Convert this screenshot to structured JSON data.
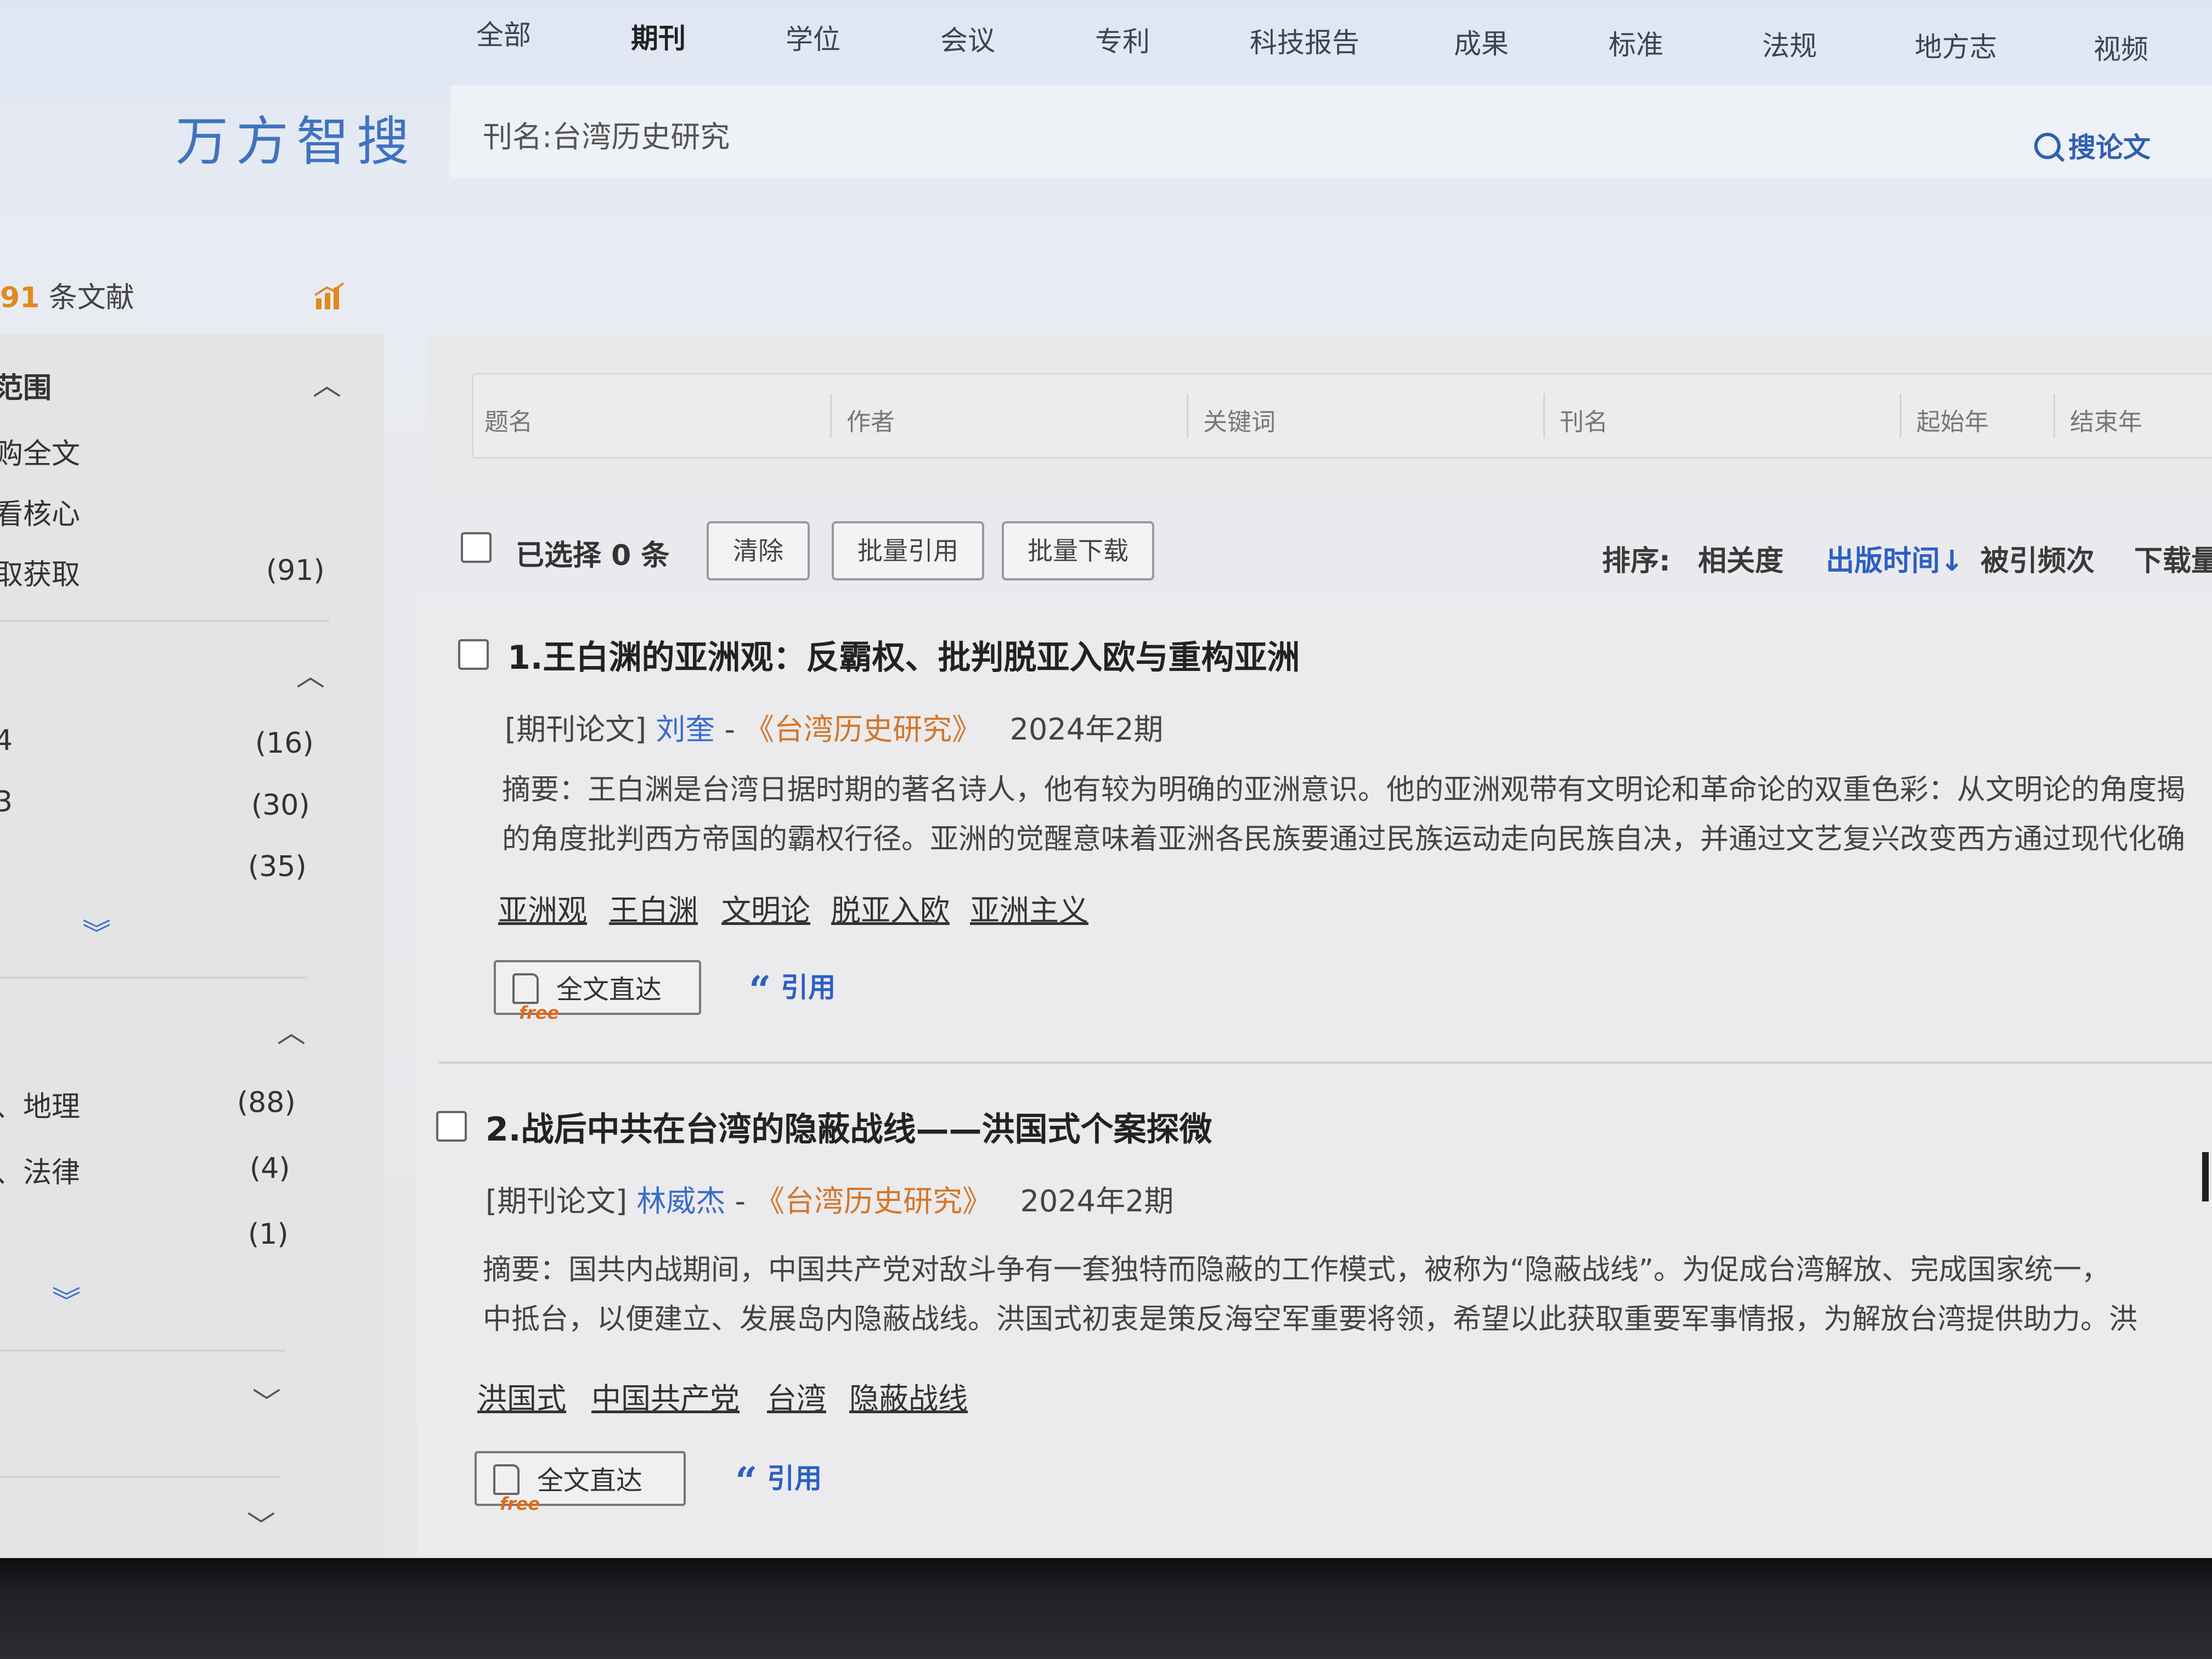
{
  "topnav": {
    "items": [
      "全部",
      "期刊",
      "学位",
      "会议",
      "专利",
      "科技报告",
      "成果",
      "标准",
      "法规",
      "地方志",
      "视频"
    ],
    "active": "期刊"
  },
  "logo": "万方智搜",
  "search": {
    "query": "刊名:台湾历史研究",
    "button_label": "搜论文"
  },
  "result_count": {
    "number": "91",
    "suffix": "条文献"
  },
  "sidebar": {
    "section1_title": "范围",
    "items1": [
      {
        "label": "购全文",
        "count": ""
      },
      {
        "label": "看核心",
        "count": ""
      },
      {
        "label": "取获取",
        "count": "(91)"
      }
    ],
    "items2": [
      {
        "label": "4",
        "count": "(16)"
      },
      {
        "label": "3",
        "count": "(30)"
      },
      {
        "label": "",
        "count": "(35)"
      }
    ],
    "items3": [
      {
        "label": "、地理",
        "count": "(88)"
      },
      {
        "label": "、法律",
        "count": "(4)"
      },
      {
        "label": "",
        "count": "(1)"
      }
    ]
  },
  "filters": {
    "fields": [
      "题名",
      "作者",
      "关键词",
      "刊名",
      "起始年",
      "结束年"
    ]
  },
  "toolbar": {
    "selected_label": "已选择 0 条",
    "clear": "清除",
    "batch_cite": "批量引用",
    "batch_download": "批量下载",
    "sort_label": "排序:",
    "sort_options": [
      "相关度",
      "出版时间↓",
      "被引频次",
      "下载量"
    ],
    "sort_active": "出版时间↓"
  },
  "results": [
    {
      "title": "1.王白渊的亚洲观：反霸权、批判脱亚入欧与重构亚洲",
      "type": "[期刊论文]",
      "author": "刘奎",
      "sep": " - ",
      "journal": "《台湾历史研究》",
      "issue": "2024年2期",
      "abstract_line1": "摘要：王白渊是台湾日据时期的著名诗人，他有较为明确的亚洲意识。他的亚洲观带有文明论和革命论的双重色彩：从文明论的角度揭",
      "abstract_line2": "的角度批判西方帝国的霸权行径。亚洲的觉醒意味着亚洲各民族要通过民族运动走向民族自决，并通过文艺复兴改变西方通过现代化确",
      "keywords": [
        "亚洲观",
        "王白渊",
        "文明论",
        "脱亚入欧",
        "亚洲主义"
      ],
      "fulltext_label": "全文直达",
      "cite_label": "引用"
    },
    {
      "title": "2.战后中共在台湾的隐蔽战线——洪国式个案探微",
      "type": "[期刊论文]",
      "author": "林威杰",
      "sep": " - ",
      "journal": "《台湾历史研究》",
      "issue": "2024年2期",
      "abstract_line1": "摘要：国共内战期间，中国共产党对敌斗争有一套独特而隐蔽的工作模式，被称为“隐蔽战线”。为促成台湾解放、完成国家统一，",
      "abstract_line2": "中抵台，以便建立、发展岛内隐蔽战线。洪国式初衷是策反海空军重要将领，希望以此获取重要军事情报，为解放台湾提供助力。洪",
      "keywords": [
        "洪国式",
        "中国共产党",
        "台湾",
        "隐蔽战线"
      ],
      "fulltext_label": "全文直达",
      "cite_label": "引用"
    }
  ],
  "free_badge": "free",
  "colors": {
    "brand_blue": "#3f73c0",
    "link_blue": "#2c5fc4",
    "journal_orange": "#d4762a",
    "count_orange": "#e08a1e"
  }
}
